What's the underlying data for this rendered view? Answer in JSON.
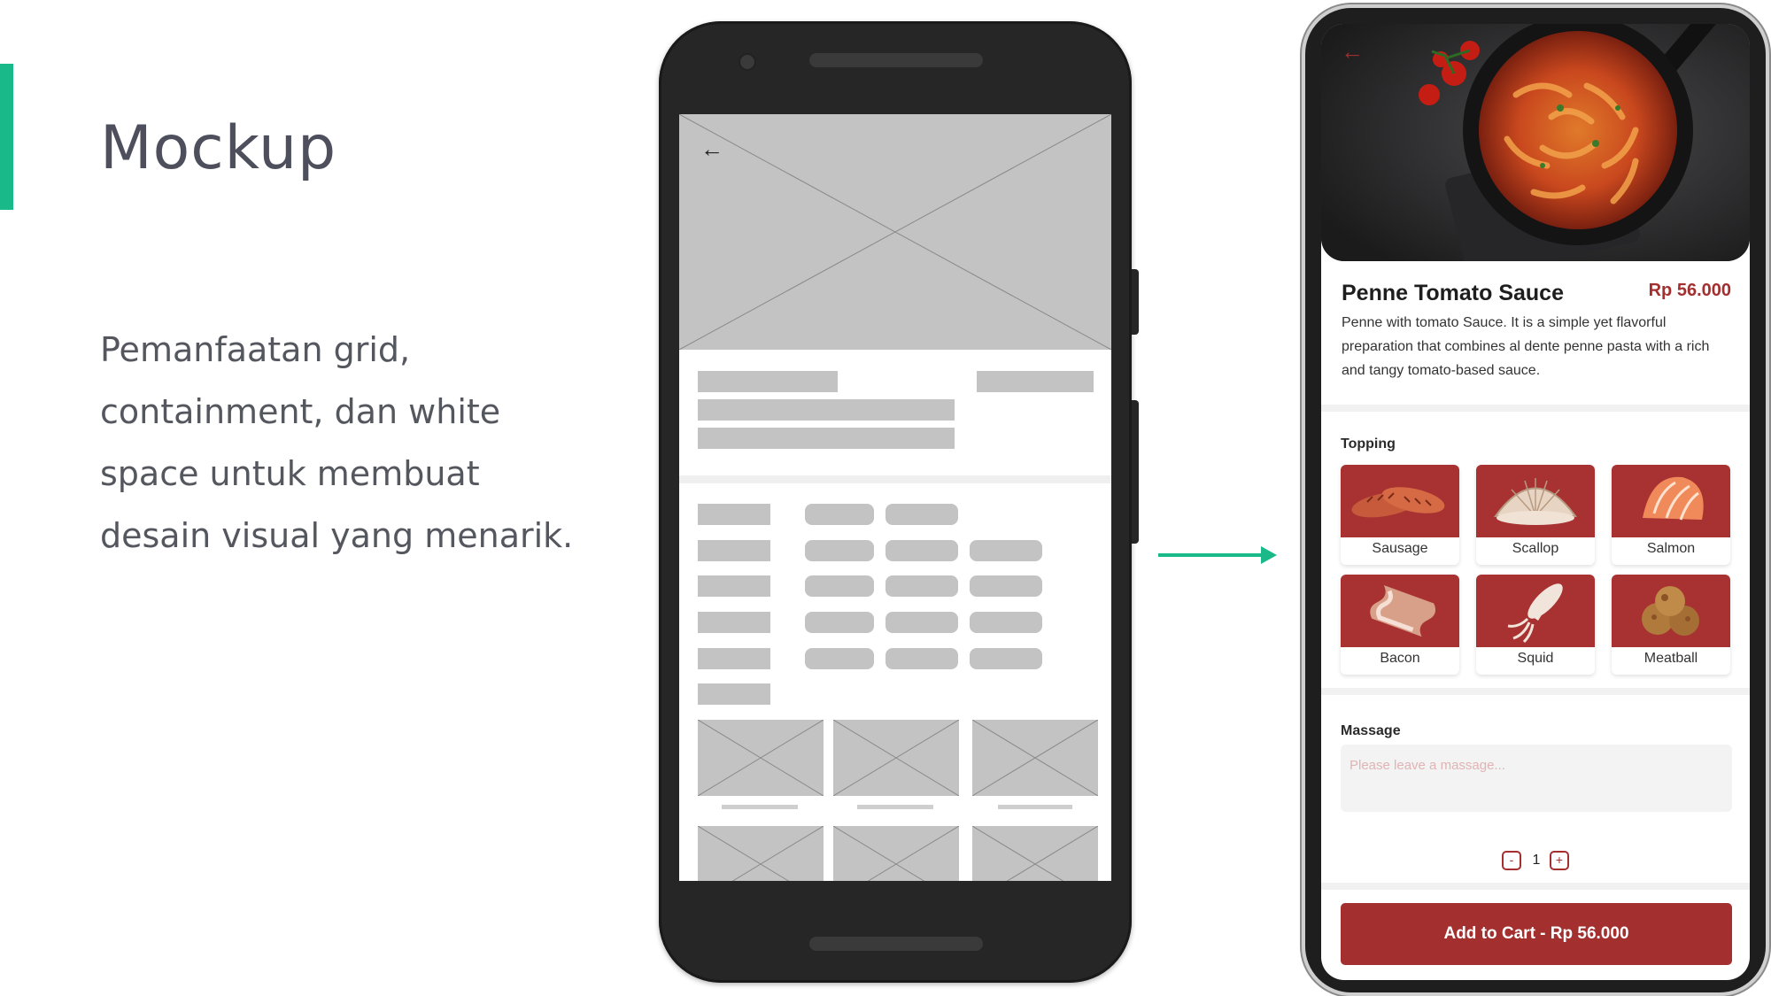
{
  "slide": {
    "title": "Mockup",
    "body_lines": [
      "Pemanfaatan grid,",
      "containment, dan white",
      "space untuk membuat",
      "desain visual yang menarik."
    ],
    "accent_color": "#19b98a"
  },
  "wireframe": {
    "back_icon": "←"
  },
  "app": {
    "back_icon": "←",
    "dish_name": "Penne Tomato Sauce",
    "dish_price": "Rp 56.000",
    "description": "Penne with tomato Sauce. It is a simple yet flavorful preparation that combines al dente penne pasta with a rich and tangy tomato-based sauce.",
    "topping_label": "Topping",
    "toppings": [
      {
        "label": "Sausage"
      },
      {
        "label": "Scallop"
      },
      {
        "label": "Salmon"
      },
      {
        "label": "Bacon"
      },
      {
        "label": "Squid"
      },
      {
        "label": "Meatball"
      }
    ],
    "message_label": "Massage",
    "message_placeholder": "Please leave a massage...",
    "qty_minus": "-",
    "qty_value": "1",
    "qty_plus": "+",
    "cart_button": "Add to Cart - Rp 56.000",
    "brand_color": "#a32f2f"
  }
}
